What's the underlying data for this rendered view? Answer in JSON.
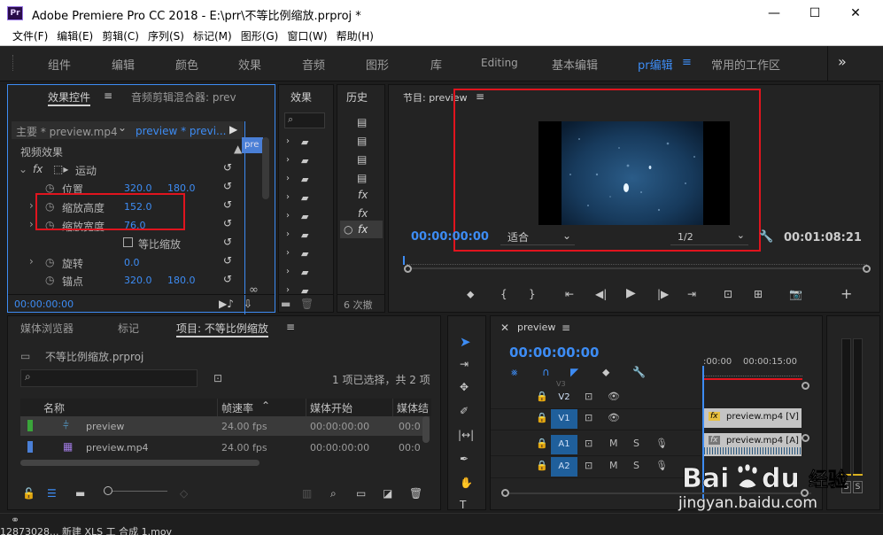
{
  "window": {
    "app_icon": "Pr",
    "title": "Adobe Premiere Pro CC 2018 - E:\\prr\\不等比例缩放.prproj *",
    "minimize": "—",
    "maximize": "☐",
    "close": "✕"
  },
  "menu": [
    "文件(F)",
    "编辑(E)",
    "剪辑(C)",
    "序列(S)",
    "标记(M)",
    "图形(G)",
    "窗口(W)",
    "帮助(H)"
  ],
  "workspaces": [
    "组件",
    "编辑",
    "颜色",
    "效果",
    "音频",
    "图形",
    "库",
    "Editing",
    "基本编辑",
    "pr编辑",
    "常用的工作区"
  ],
  "workspace_overflow": "»",
  "effect_controls": {
    "tab_active": "效果控件",
    "tab_menu": "≡",
    "tab_other": "音频剪辑混合器: prev",
    "master_label": "主要 * preview.mp4",
    "sequence_label": "preview * previ...",
    "mini_clip": "pre",
    "video_effects": "视频效果",
    "fx_badge": "fx",
    "motion": "运动",
    "position_label": "位置",
    "position_x": "320.0",
    "position_y": "180.0",
    "scale_height_label": "缩放高度",
    "scale_height_value": "152.0",
    "scale_width_label": "缩放宽度",
    "scale_width_value": "76.0",
    "uniform_scale_label": "等比缩放",
    "rotation_label": "旋转",
    "rotation_value": "0.0",
    "anchor_label": "锚点",
    "anchor_x": "320.0",
    "anchor_y": "180.0",
    "timecode": "00:00:00:00"
  },
  "effects_panel": {
    "title": "效果",
    "folders": 9
  },
  "history_panel": {
    "title": "历史",
    "footer": "6 次撤",
    "fx_rows": [
      "fx",
      "fx",
      "fx"
    ]
  },
  "program_monitor": {
    "title": "节目: preview",
    "menu": "≡",
    "timecode": "00:00:00:00",
    "fit": "适合",
    "resolution": "1/2",
    "duration": "00:01:08:21"
  },
  "project_panel": {
    "tab_media": "媒体浏览器",
    "tab_markers": "标记",
    "tab_project": "项目: 不等比例缩放",
    "tab_menu": "≡",
    "project_file": "不等比例缩放.prproj",
    "selection_info": "1 项已选择，共 2 项",
    "columns": [
      "名称",
      "帧速率",
      "媒体开始",
      "媒体结"
    ],
    "rows": [
      {
        "name": "preview",
        "fps": "24.00 fps",
        "start": "00:00:00:00",
        "end": "00:0",
        "color": "#3aa53a"
      },
      {
        "name": "preview.mp4",
        "fps": "24.00 fps",
        "start": "00:00:00:00",
        "end": "00:0",
        "color": "#4a7fd6"
      }
    ]
  },
  "timeline": {
    "title": "preview",
    "menu": "≡",
    "timecode": "00:00:00:00",
    "ruler_start": ":00:00",
    "ruler_mark": "00:00:15:00",
    "tracks": [
      {
        "name": "V2",
        "type": "video"
      },
      {
        "name": "V1",
        "type": "video"
      },
      {
        "name": "A1",
        "type": "audio"
      },
      {
        "name": "A2",
        "type": "audio"
      }
    ],
    "above_label": "V3",
    "clip_video": "preview.mp4 [V]",
    "clip_audio": "preview.mp4 [A]",
    "fx": "fx",
    "m": "M",
    "s": "S"
  },
  "audio_meter": {
    "s_left": "S",
    "s_right": "S"
  },
  "taskbar": "12873028...  新建 XLS 工  合成 1.mov",
  "watermark": {
    "brand": "Bai",
    "brand2": "du",
    "sub": "经验",
    "url": "jingyan.baidu.com"
  },
  "colors": {
    "accent": "#3d8cf4",
    "highlight": "#e0141e",
    "panel": "#232323",
    "bg": "#1d1d1d"
  }
}
